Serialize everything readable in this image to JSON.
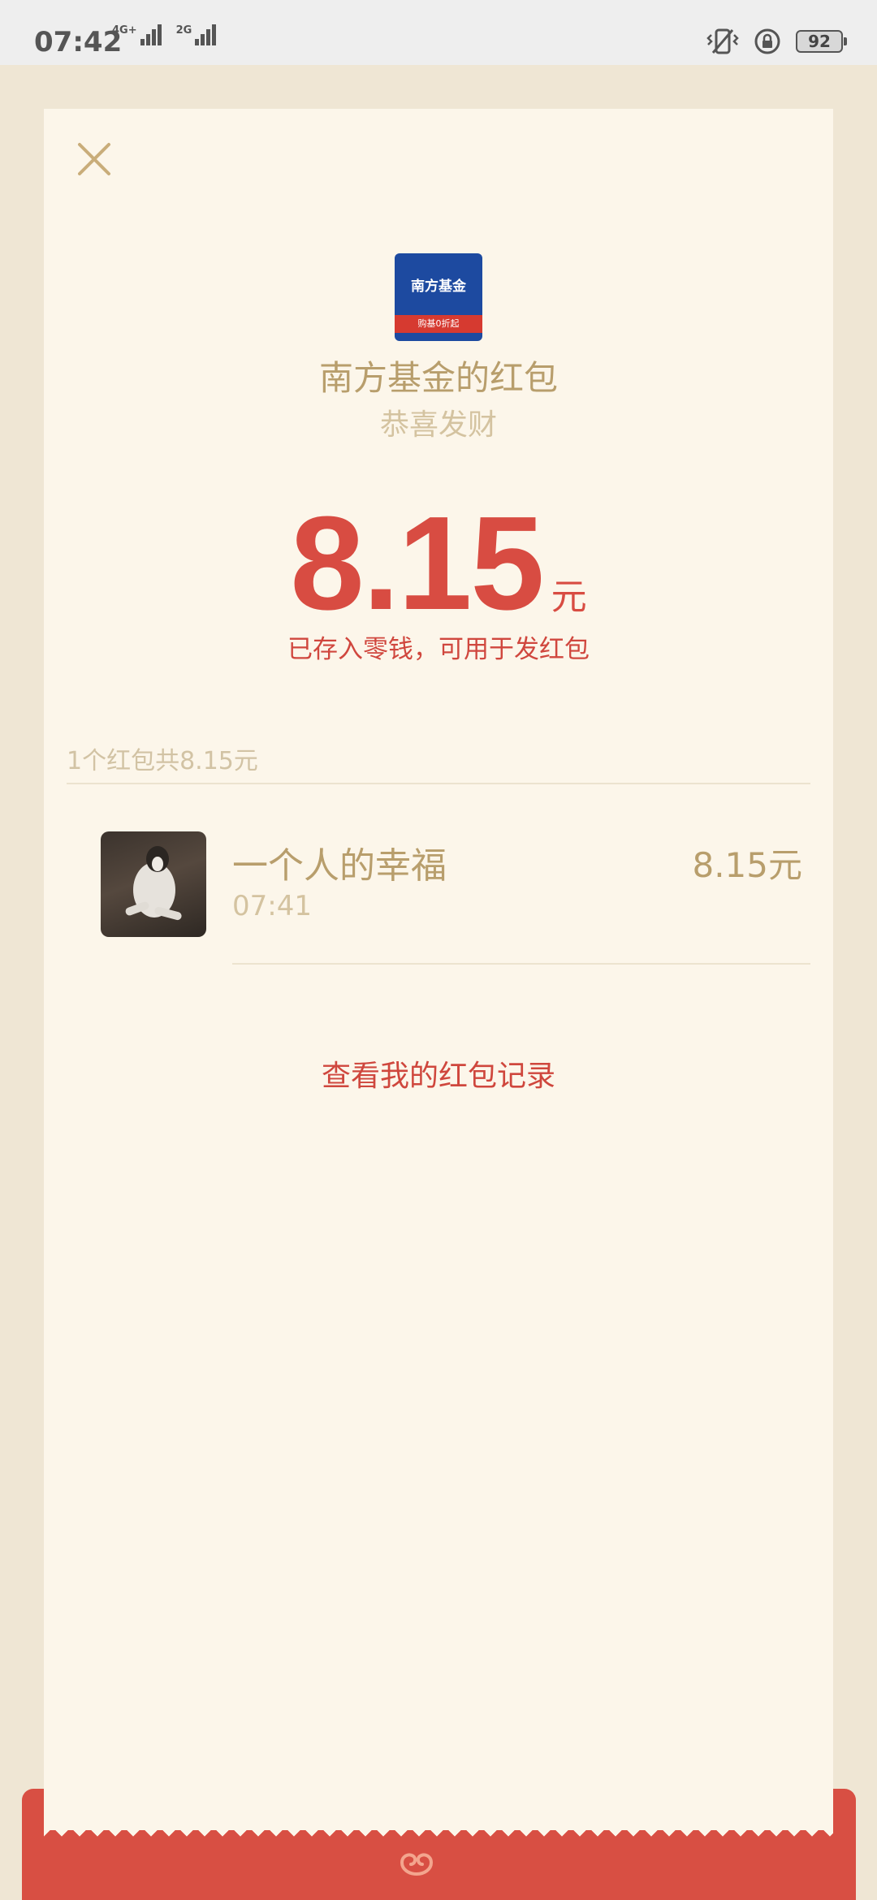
{
  "status_bar": {
    "time": "07:42",
    "network_1": "4G+",
    "network_2": "2G",
    "battery": "92"
  },
  "packet": {
    "sender_logo_text": "南方基金",
    "sender_logo_slogan": "购基0折起",
    "title": "南方基金的红包",
    "wish": "恭喜发财",
    "amount": "8.15",
    "unit": "元",
    "stored_note": "已存入零钱，可用于发红包"
  },
  "summary": "1个红包共8.15元",
  "records": [
    {
      "name": "一个人的幸福",
      "time": "07:41",
      "amount": "8.15元"
    }
  ],
  "history_link": "查看我的红包记录",
  "colors": {
    "accent_red": "#d84c42",
    "gold_text": "#b89e6c",
    "card_bg": "#fcf6ea",
    "page_bg": "#efe6d4"
  }
}
